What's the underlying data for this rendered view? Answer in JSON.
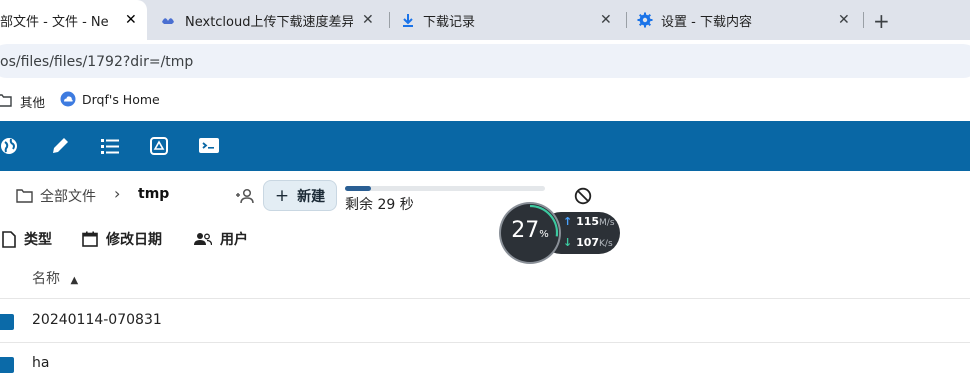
{
  "browser": {
    "tabs": [
      {
        "title": "部文件 - 文件 - Nextc",
        "active": true,
        "icon": "nextcloud-icon"
      },
      {
        "title": "Nextcloud上传下载速度差异分",
        "active": false,
        "icon": "nextcloud-icon"
      },
      {
        "title": "下载记录",
        "active": false,
        "icon": "download-icon"
      },
      {
        "title": "设置 - 下载内容",
        "active": false,
        "icon": "gear-icon"
      }
    ],
    "close_glyph": "✕",
    "new_tab_glyph": "+",
    "url": "os/files/files/1792?dir=/tmp",
    "bookmarks": [
      {
        "label": "其他",
        "icon": "folder-icon"
      },
      {
        "label": "Drqf's Home",
        "icon": "home-cloud-icon"
      }
    ]
  },
  "nextcloud": {
    "header_icons": [
      "globe-icon",
      "pencil-icon",
      "list-icon",
      "recycle-icon",
      "terminal-icon"
    ],
    "breadcrumb": {
      "root": "全部文件",
      "separator": "›",
      "current": "tmp"
    },
    "new_button": {
      "icon": "+",
      "label": "新建"
    },
    "upload": {
      "progress": 0.13,
      "remaining": "剩余 29 秒"
    },
    "filters": [
      {
        "label": "类型",
        "icon": "file-icon"
      },
      {
        "label": "修改日期",
        "icon": "calendar-icon"
      },
      {
        "label": "用户",
        "icon": "users-icon"
      }
    ],
    "sort": {
      "label": "名称",
      "direction": "▲"
    },
    "files": [
      {
        "name": "20240114-070831"
      },
      {
        "name": "ha"
      }
    ]
  },
  "speed_widget": {
    "percent": "27",
    "percent_unit": "%",
    "upload": {
      "arrow": "↑",
      "value": "115",
      "unit": "M/s"
    },
    "download": {
      "arrow": "↓",
      "value": "107",
      "unit": "K/s"
    }
  },
  "colors": {
    "header": "#0967a5",
    "accent": "#0b6aa8",
    "tabstrip": "#dfe3eb"
  }
}
